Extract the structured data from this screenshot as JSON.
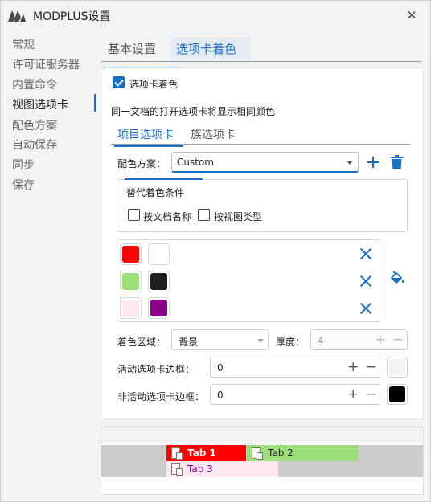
{
  "window": {
    "title": "MODPLUS设置",
    "close_icon": "close-icon"
  },
  "sidebar": {
    "items": [
      {
        "label": "常规"
      },
      {
        "label": "许可证服务器"
      },
      {
        "label": "内置命令"
      },
      {
        "label": "视图选项卡",
        "active": true
      },
      {
        "label": "配色方案"
      },
      {
        "label": "自动保存"
      },
      {
        "label": "同步"
      },
      {
        "label": "保存"
      }
    ]
  },
  "tabs": [
    {
      "label": "基本设置"
    },
    {
      "label": "选项卡着色",
      "active": true
    }
  ],
  "panel": {
    "enable_label": "选项卡着色",
    "enable_checked": true,
    "description": "同一文档的打开选项卡将显示相同颜色",
    "subtabs": [
      {
        "label": "项目选项卡",
        "active": true
      },
      {
        "label": "族选项卡"
      }
    ],
    "scheme": {
      "label": "配色方案：",
      "value": "Custom"
    },
    "alt_conditions": {
      "title": "替代着色条件",
      "by_doc_name": "按文档名称",
      "by_view_type": "按视图类型"
    },
    "color_rows": [
      {
        "fill": "#ff0000",
        "text": "#ffffff"
      },
      {
        "fill": "#9de07a",
        "text": "#1e1e1e"
      },
      {
        "fill": "#ffe8ef",
        "text": "#8b008b"
      }
    ],
    "color_area": {
      "label": "着色区域：",
      "value": "背景"
    },
    "thickness": {
      "label": "厚度：",
      "value": "4"
    },
    "active_border": {
      "label": "活动选项卡边框：",
      "value": "0",
      "color": "#f3f3f3"
    },
    "inactive_border": {
      "label": "非活动选项卡边框：",
      "value": "0",
      "color": "#000000"
    }
  },
  "preview": {
    "tabs": [
      {
        "label": "Tab 1",
        "bg": "#ff0000",
        "fg": "#ffffff"
      },
      {
        "label": "Tab 2",
        "bg": "#9de07a",
        "fg": "#1e1e1e"
      },
      {
        "label": "Tab 3",
        "bg": "#ffe8ef",
        "fg": "#8b008b"
      }
    ]
  },
  "colors": {
    "accent": "#1a6fc4"
  }
}
